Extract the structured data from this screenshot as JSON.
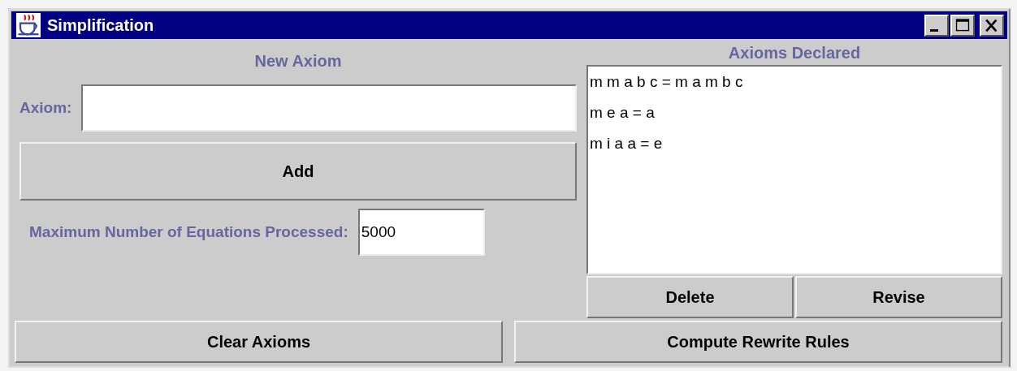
{
  "window": {
    "title": "Simplification"
  },
  "new_axiom": {
    "heading": "New Axiom",
    "label": "Axiom:",
    "add_button": "Add"
  },
  "max_equations": {
    "label": "Maximum Number of Equations Processed:",
    "value": "5000"
  },
  "axioms_declared": {
    "heading": "Axioms Declared",
    "items": [
      {
        "text": "m m a b c = m a m b c"
      },
      {
        "text": "m e a = a"
      },
      {
        "text": "m i a a = e"
      }
    ],
    "buttons": [
      "Delete",
      "Revise"
    ]
  },
  "bottom_buttons": [
    "Clear Axioms",
    "Compute Rewrite Rules"
  ]
}
